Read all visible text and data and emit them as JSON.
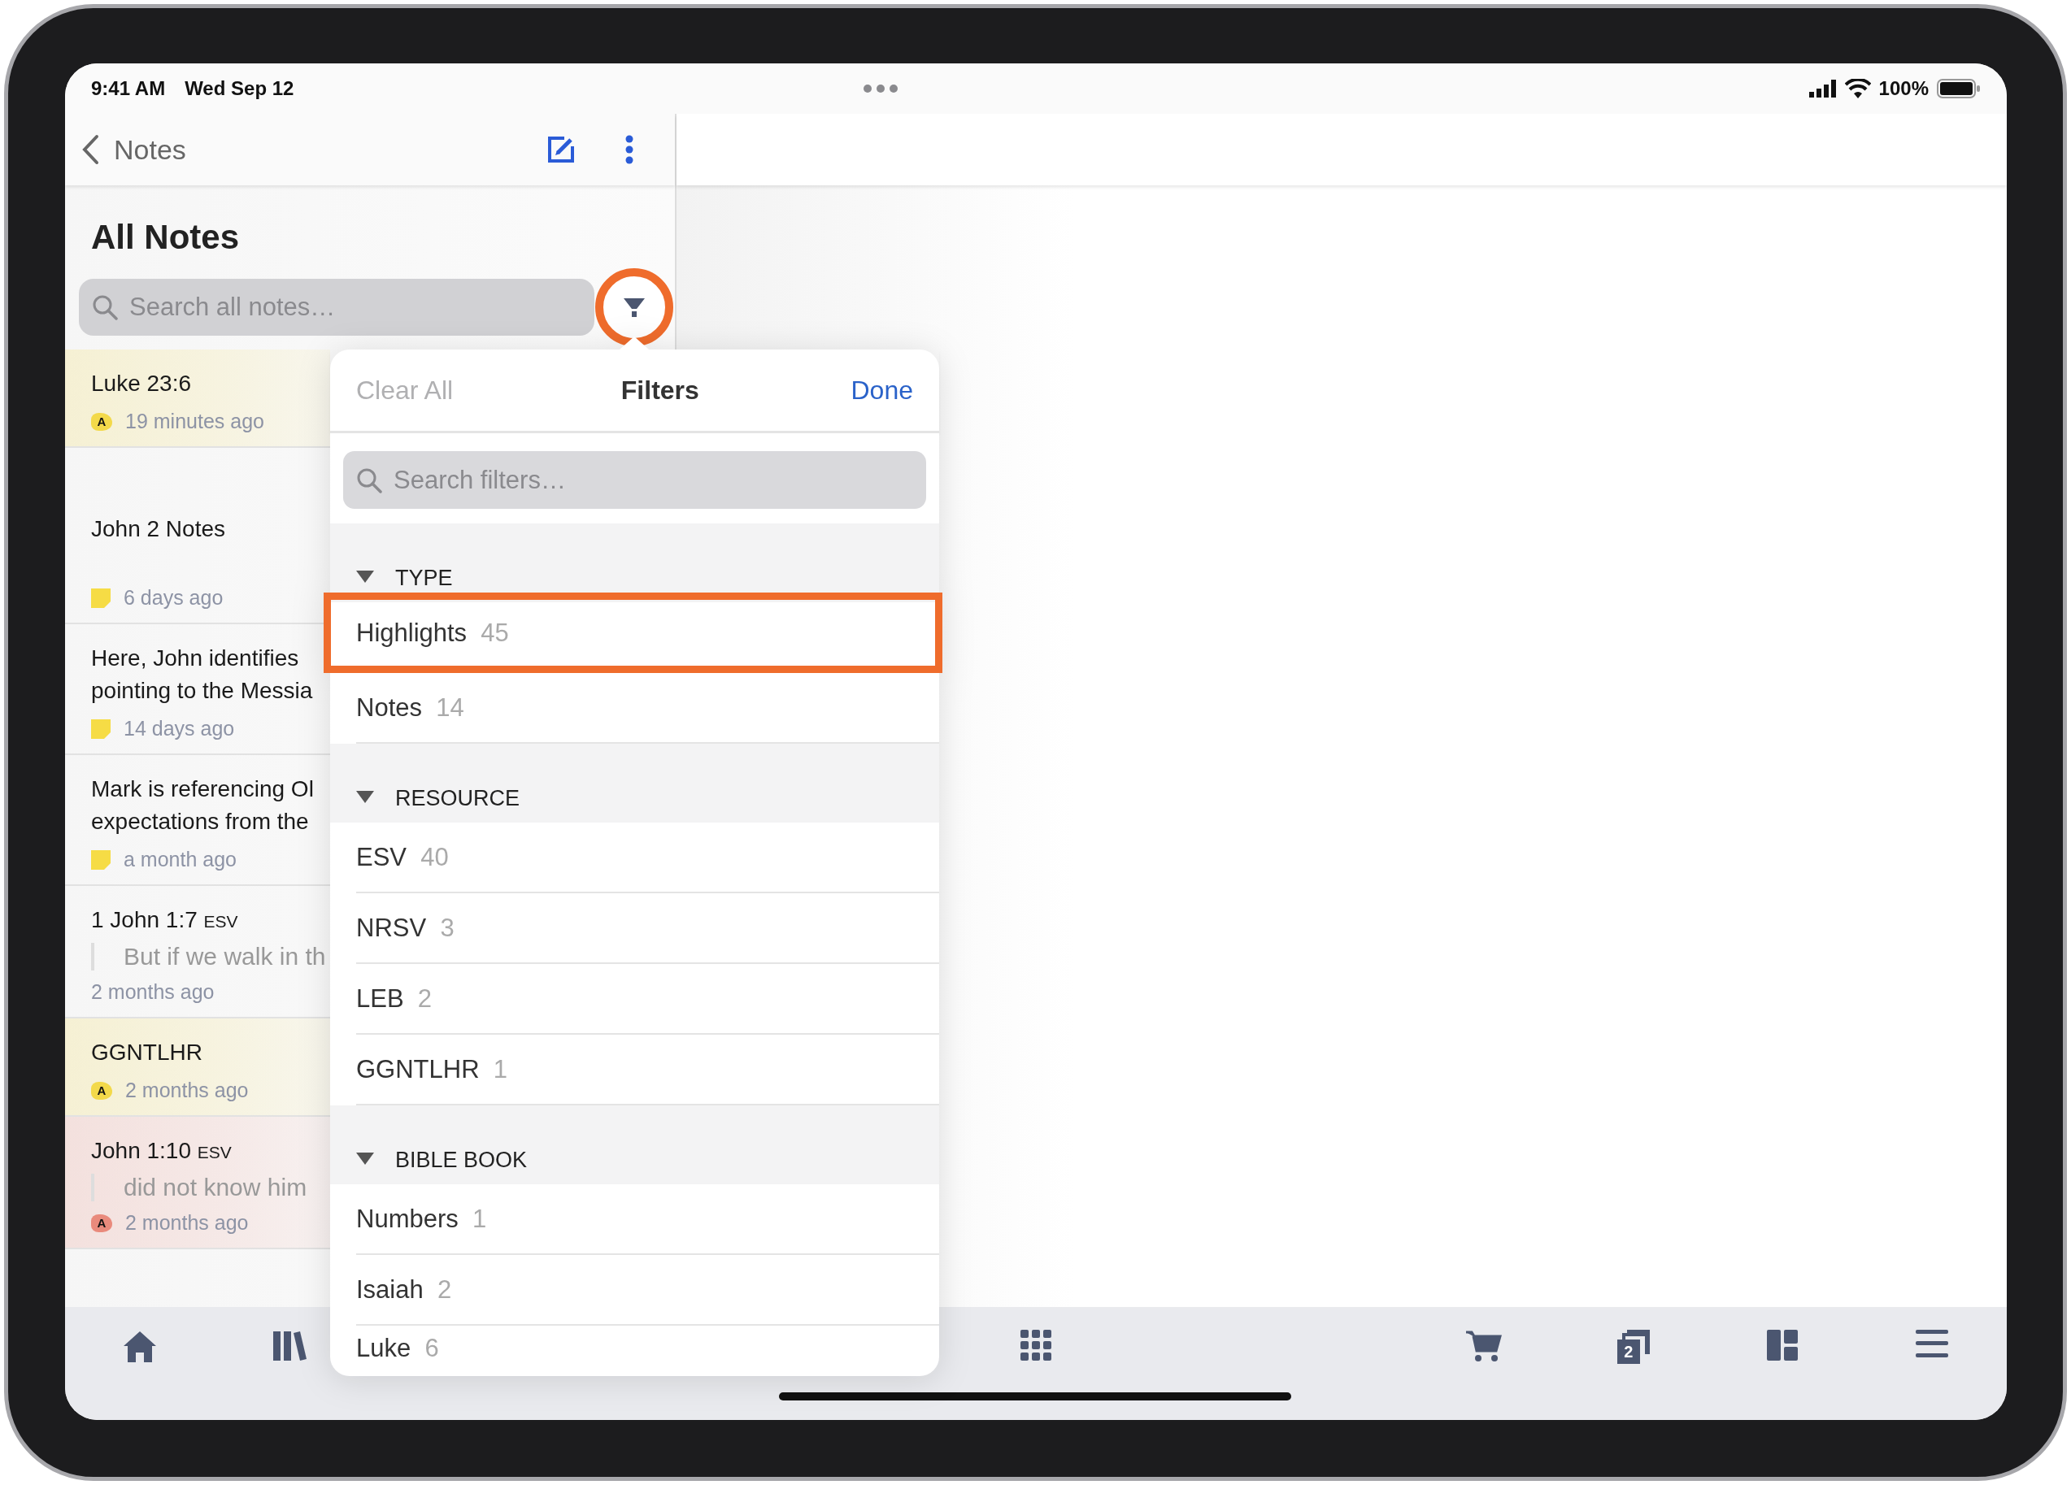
{
  "status_bar": {
    "time": "9:41 AM",
    "date": "Wed Sep 12",
    "battery": "100%"
  },
  "nav": {
    "back_label": "Notes"
  },
  "title": "All Notes",
  "search": {
    "placeholder": "Search all notes…"
  },
  "filter_button": {
    "emphasized": true
  },
  "notes": [
    {
      "kind": "highlight",
      "color": "#f3d94a",
      "badge": "A",
      "lines": [
        "Luke 23:6"
      ],
      "time": "19 minutes ago"
    },
    {
      "kind": "note",
      "color": "#f6dc45",
      "lines": [
        "John 2 Notes"
      ],
      "time": "6 days ago"
    },
    {
      "kind": "note",
      "color": "#f6dc45",
      "lines": [
        "Here, John identifies",
        "pointing to the Messia"
      ],
      "time": "14 days ago"
    },
    {
      "kind": "note",
      "color": "#f6dc45",
      "lines": [
        "Mark is referencing Ol",
        "expectations from the"
      ],
      "time": "a month ago"
    },
    {
      "kind": "plain",
      "lines": [
        "1 John 1:7"
      ],
      "edition": "ESV",
      "quote": "But if we walk in th",
      "time": "2 months ago"
    },
    {
      "kind": "highlight",
      "color": "#f3d94a",
      "badge": "A",
      "lines": [
        "GGNTLHR"
      ],
      "time": "2 months ago"
    },
    {
      "kind": "highlight",
      "color": "#e98a7c",
      "badge": "A",
      "lines": [
        "John 1:10"
      ],
      "edition": "ESV",
      "quote": "did not know him",
      "time": "2 months ago"
    }
  ],
  "filters": {
    "clear_label": "Clear All",
    "clear_disabled": true,
    "title": "Filters",
    "done_label": "Done",
    "search_placeholder": "Search filters…",
    "sections": [
      {
        "title": "TYPE",
        "expanded": true,
        "items": [
          {
            "label": "Highlights",
            "count": "45",
            "emphasized": true
          },
          {
            "label": "Notes",
            "count": "14",
            "emphasized": false
          }
        ]
      },
      {
        "title": "RESOURCE",
        "expanded": true,
        "items": [
          {
            "label": "ESV",
            "count": "40",
            "emphasized": false
          },
          {
            "label": "NRSV",
            "count": "3",
            "emphasized": false
          },
          {
            "label": "LEB",
            "count": "2",
            "emphasized": false
          },
          {
            "label": "GGNTLHR",
            "count": "1",
            "emphasized": false
          }
        ]
      },
      {
        "title": "BIBLE BOOK",
        "expanded": true,
        "items": [
          {
            "label": "Numbers",
            "count": "1",
            "emphasized": false
          },
          {
            "label": "Isaiah",
            "count": "2",
            "emphasized": false
          },
          {
            "label": "Luke",
            "count": "6",
            "emphasized": false
          }
        ]
      }
    ]
  },
  "tab_bar": [
    {
      "kind": "home"
    },
    {
      "kind": "library"
    },
    {
      "kind": "apps"
    },
    {
      "kind": "cart"
    },
    {
      "kind": "documents",
      "badge": "2"
    },
    {
      "kind": "layout"
    },
    {
      "kind": "menu"
    }
  ]
}
